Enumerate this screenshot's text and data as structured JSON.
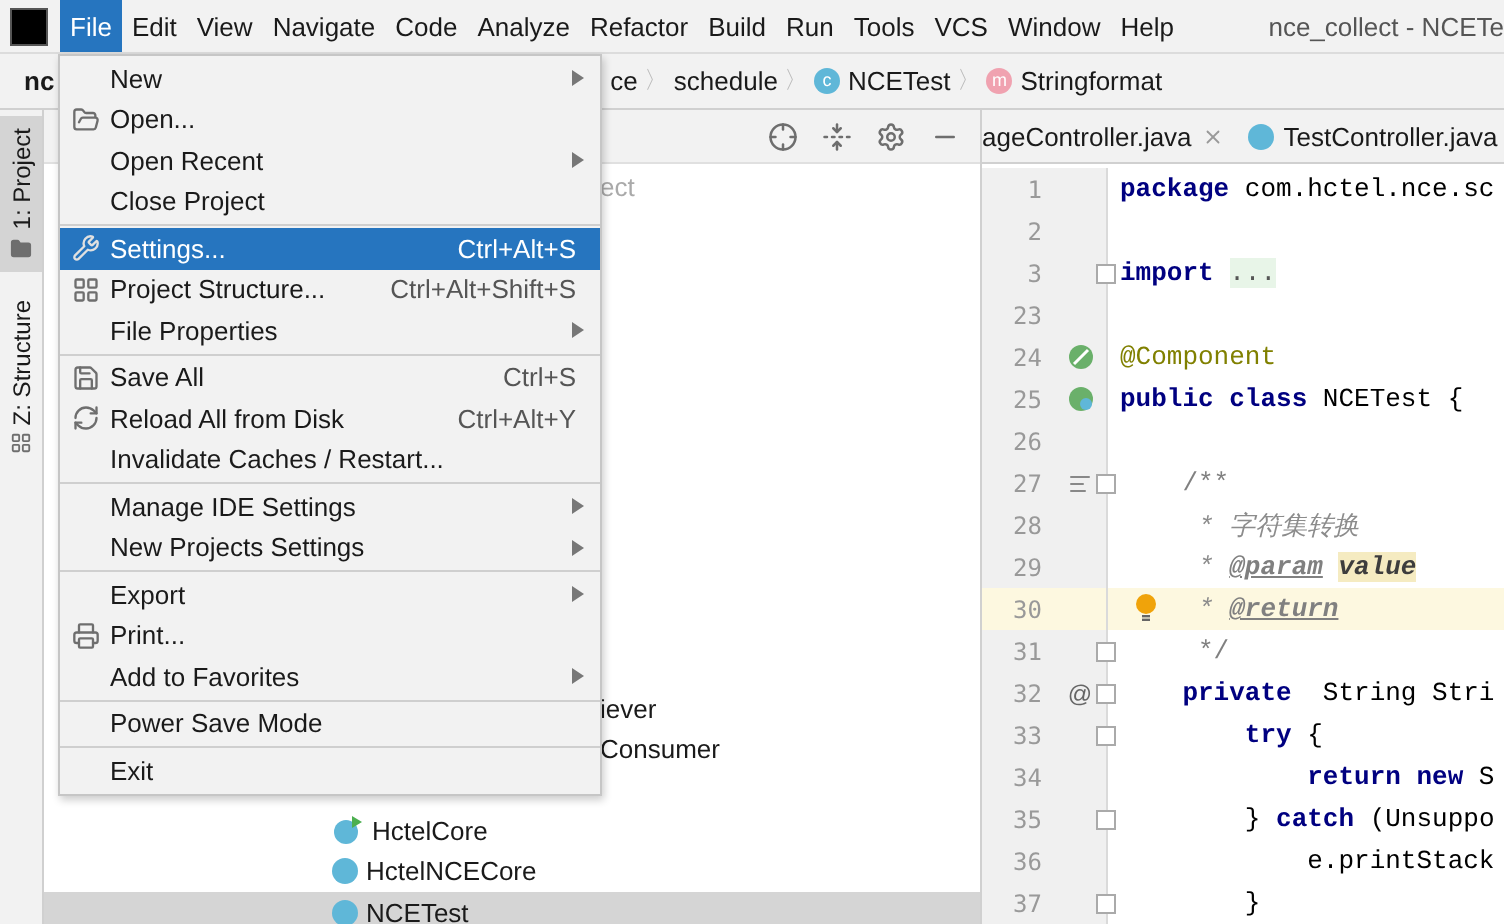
{
  "window": {
    "title": "nce_collect - NCETe"
  },
  "menubar": [
    {
      "label": "File",
      "selected": true
    },
    {
      "label": "Edit",
      "selected": false
    },
    {
      "label": "View",
      "selected": false
    },
    {
      "label": "Navigate",
      "selected": false
    },
    {
      "label": "Code",
      "selected": false
    },
    {
      "label": "Analyze",
      "selected": false
    },
    {
      "label": "Refactor",
      "selected": false
    },
    {
      "label": "Build",
      "selected": false
    },
    {
      "label": "Run",
      "selected": false
    },
    {
      "label": "Tools",
      "selected": false
    },
    {
      "label": "VCS",
      "selected": false
    },
    {
      "label": "Window",
      "selected": false
    },
    {
      "label": "Help",
      "selected": false
    }
  ],
  "breadcrumbs": [
    {
      "label": "nc",
      "kind": "root"
    },
    {
      "label": "ce",
      "kind": "folder"
    },
    {
      "label": "schedule",
      "kind": "folder",
      "separator": "〉"
    },
    {
      "label": "NCETest",
      "kind": "class",
      "separator": "〉",
      "badge": "c"
    },
    {
      "label": "Stringformat",
      "kind": "method",
      "separator": "〉",
      "badge": "m"
    }
  ],
  "tool_strip": [
    {
      "label": "1: Project",
      "selected": true,
      "kind": "project"
    },
    {
      "label": "Z: Structure",
      "selected": false,
      "kind": "structure"
    }
  ],
  "project_panel": {
    "hint": "ect",
    "tree": [
      {
        "label": "iever",
        "kind": "partial",
        "selected": false
      },
      {
        "label": "Consumer",
        "kind": "partial",
        "selected": false
      },
      {
        "label": "HctelCore",
        "kind": "runnable",
        "selected": false
      },
      {
        "label": "HctelNCECore",
        "kind": "class",
        "selected": false
      },
      {
        "label": "NCETest",
        "kind": "class",
        "selected": true
      }
    ]
  },
  "editor_tabs": [
    {
      "label": "ageController.java",
      "kind": "closable"
    },
    {
      "label": "TestController.java",
      "kind": "class"
    }
  ],
  "code_lines": [
    {
      "number": "1",
      "kind": "plain",
      "tokens": [
        {
          "text": "package",
          "kind": "kw"
        },
        {
          "text": " com.hctel.nce.sc",
          "kind": "plain"
        }
      ]
    },
    {
      "number": "2",
      "kind": "plain"
    },
    {
      "number": "3",
      "kind": "plain",
      "fold": true,
      "tokens": [
        {
          "text": "import",
          "kind": "kw"
        },
        {
          "text": "...",
          "kind": "folded"
        }
      ]
    },
    {
      "number": "23",
      "kind": "plain"
    },
    {
      "number": "24",
      "kind": "bean",
      "tokens": [
        {
          "text": "@Component",
          "kind": "anno"
        }
      ]
    },
    {
      "number": "25",
      "kind": "bean-class",
      "tokens": [
        {
          "text": "public class",
          "kind": "kw"
        },
        {
          "text": " NCETest {",
          "kind": "plain"
        }
      ]
    },
    {
      "number": "26",
      "kind": "plain"
    },
    {
      "number": "27",
      "kind": "doc",
      "fold": true,
      "tokens": [
        {
          "text": "    /**",
          "kind": "comment"
        }
      ]
    },
    {
      "number": "28",
      "kind": "plain",
      "tokens": [
        {
          "text": "     * 字符集转换",
          "kind": "doc"
        }
      ]
    },
    {
      "number": "29",
      "kind": "plain",
      "tokens": [
        {
          "text": "     * ",
          "kind": "doc"
        },
        {
          "text": "@param",
          "kind": "doctag"
        },
        {
          "text": "value",
          "kind": "docvalue"
        }
      ]
    },
    {
      "number": "30",
      "kind": "plain",
      "current": true,
      "bulb": true,
      "tokens": [
        {
          "text": "     * ",
          "kind": "doc"
        },
        {
          "text": "@return",
          "kind": "doctag"
        }
      ]
    },
    {
      "number": "31",
      "kind": "plain",
      "fold": true,
      "tokens": [
        {
          "text": "     */",
          "kind": "comment"
        }
      ]
    },
    {
      "number": "32",
      "kind": "plain",
      "gutter_text": "@",
      "fold": true,
      "tokens": [
        {
          "text": "    private",
          "kind": "kw"
        },
        {
          "text": "  String Stri",
          "kind": "plain"
        }
      ]
    },
    {
      "number": "33",
      "kind": "plain",
      "fold": true,
      "tokens": [
        {
          "text": "        try",
          "kind": "kw"
        },
        {
          "text": " {",
          "kind": "plain"
        }
      ]
    },
    {
      "number": "34",
      "kind": "plain",
      "tokens": [
        {
          "text": "            return new",
          "kind": "kw"
        },
        {
          "text": " S",
          "kind": "plain"
        }
      ]
    },
    {
      "number": "35",
      "kind": "plain",
      "fold": true,
      "tokens": [
        {
          "text": "        } ",
          "kind": "plain"
        },
        {
          "text": "catch",
          "kind": "kw"
        },
        {
          "text": " (Unsuppo",
          "kind": "plain"
        }
      ]
    },
    {
      "number": "36",
      "kind": "plain",
      "tokens": [
        {
          "text": "            e.printStack",
          "kind": "plain"
        }
      ]
    },
    {
      "number": "37",
      "kind": "plain",
      "fold": true,
      "tokens": [
        {
          "text": "        }",
          "kind": "plain"
        }
      ]
    }
  ],
  "file_menu": [
    {
      "kind": "plain",
      "label": "New",
      "submenu": true,
      "selected": false
    },
    {
      "kind": "folder",
      "label": "Open...",
      "selected": false
    },
    {
      "kind": "plain",
      "label": "Open Recent",
      "submenu": true,
      "selected": false
    },
    {
      "kind": "plain",
      "label": "Close Project",
      "selected": false
    },
    {
      "kind": "separator"
    },
    {
      "kind": "wrench",
      "label": "Settings...",
      "shortcut": "Ctrl+Alt+S",
      "selected": true
    },
    {
      "kind": "structure",
      "label": "Project Structure...",
      "shortcut": "Ctrl+Alt+Shift+S",
      "selected": false
    },
    {
      "kind": "plain",
      "label": "File Properties",
      "submenu": true,
      "selected": false
    },
    {
      "kind": "separator"
    },
    {
      "kind": "save",
      "label": "Save All",
      "shortcut": "Ctrl+S",
      "selected": false
    },
    {
      "kind": "reload",
      "label": "Reload All from Disk",
      "shortcut": "Ctrl+Alt+Y",
      "selected": false
    },
    {
      "kind": "plain",
      "label": "Invalidate Caches / Restart...",
      "selected": false
    },
    {
      "kind": "separator"
    },
    {
      "kind": "plain",
      "label": "Manage IDE Settings",
      "submenu": true,
      "selected": false
    },
    {
      "kind": "plain",
      "label": "New Projects Settings",
      "submenu": true,
      "selected": false
    },
    {
      "kind": "separator"
    },
    {
      "kind": "plain",
      "label": "Export",
      "submenu": true,
      "selected": false
    },
    {
      "kind": "print",
      "label": "Print...",
      "selected": false
    },
    {
      "kind": "plain",
      "label": "Add to Favorites",
      "submenu": true,
      "selected": false
    },
    {
      "kind": "separator"
    },
    {
      "kind": "plain",
      "label": "Power Save Mode",
      "selected": false
    },
    {
      "kind": "separator"
    },
    {
      "kind": "plain",
      "label": "Exit",
      "selected": false
    }
  ]
}
